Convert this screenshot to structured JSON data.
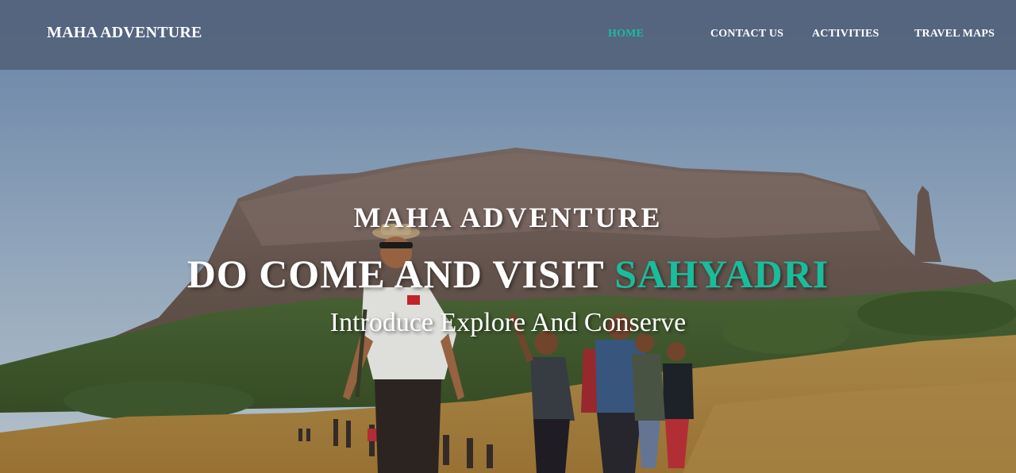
{
  "navbar": {
    "brand": "MAHA ADVENTURE",
    "links": [
      {
        "label": "HOME",
        "active": true
      },
      {
        "label": "CONTACT US",
        "active": false
      },
      {
        "label": "ACTIVITIES",
        "active": false
      },
      {
        "label": "TRAVEL MAPS",
        "active": false
      }
    ]
  },
  "hero": {
    "kicker": "MAHA ADVENTURE",
    "heading_prefix": "DO COME AND VISIT ",
    "heading_accent": "SAHYADRI",
    "subheading": "Introduce Explore And Conserve",
    "background": "photo of hikers walking across a golden meadow below a flat-topped mountain"
  },
  "colors": {
    "accent": "#1abc9c",
    "navbar_bg": "#54637c",
    "text": "#ffffff"
  }
}
